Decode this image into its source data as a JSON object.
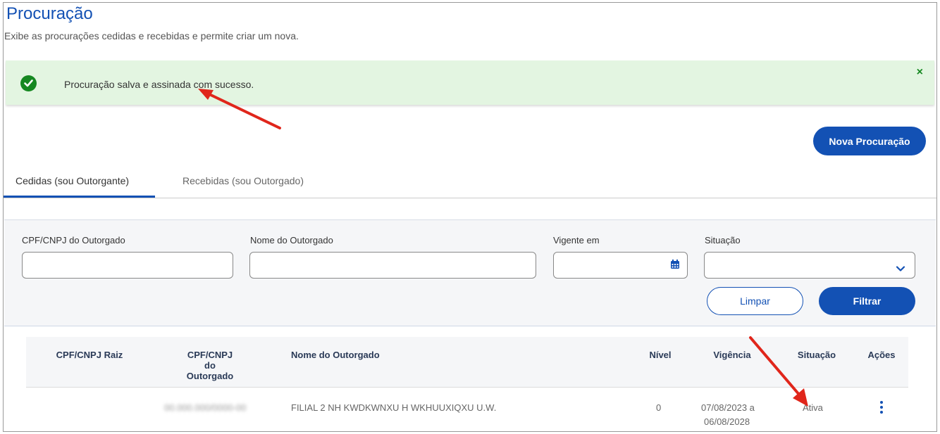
{
  "header": {
    "title": "Procuração",
    "subtitle": "Exibe as procurações cedidas e recebidas e permite criar um nova."
  },
  "alert": {
    "message": "Procuração salva e assinada com sucesso.",
    "close_label": "×",
    "icon": "check-circle-icon",
    "color": "#168821",
    "background": "#e3f5e1"
  },
  "actions": {
    "new_label": "Nova Procuração"
  },
  "tabs": [
    {
      "label": "Cedidas (sou Outorgante)",
      "active": true
    },
    {
      "label": "Recebidas (sou Outorgado)",
      "active": false
    }
  ],
  "filters": {
    "cpf_label": "CPF/CNPJ do Outorgado",
    "cpf_value": "",
    "name_label": "Nome do Outorgado",
    "name_value": "",
    "date_label": "Vigente em",
    "date_value": "",
    "status_label": "Situação",
    "status_value": "",
    "clear_label": "Limpar",
    "filter_label": "Filtrar"
  },
  "table": {
    "columns": [
      "CPF/CNPJ Raiz",
      "CPF/CNPJ do Outorgado",
      "Nome do Outorgado",
      "Nível",
      "Vigência",
      "Situação",
      "Ações"
    ],
    "rows": [
      {
        "cpf_raiz": "",
        "cpf_outorgado": "00.000.000/0000-00",
        "nome": "FILIAL 2 NH KWDKWNXU H WKHUUXIQXU U.W.",
        "nivel": "0",
        "vigencia_inicio": "07/08/2023 a",
        "vigencia_fim": "06/08/2028",
        "situacao": "Ativa"
      }
    ]
  },
  "colors": {
    "primary": "#1351b4",
    "annotation_arrow": "#e0261b"
  }
}
